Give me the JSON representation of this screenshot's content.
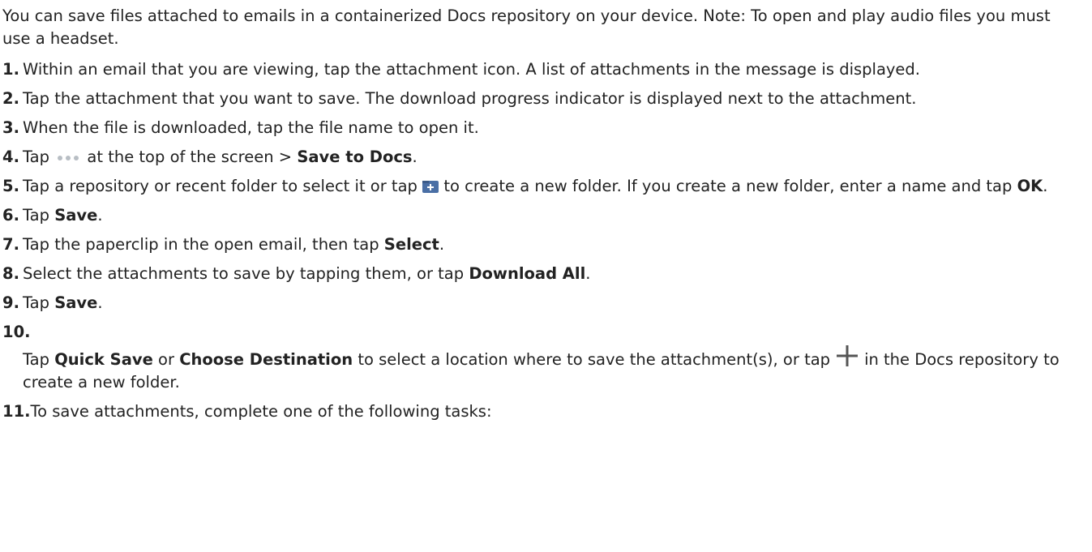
{
  "intro": "You can save files attached to emails in a containerized Docs repository on your device. Note: To open and play audio files you must use a headset.",
  "steps": [
    {
      "num": "1.",
      "text": "Within an email that you are viewing, tap the attachment icon. A list of attachments in the message is displayed."
    },
    {
      "num": "2.",
      "text": "Tap the attachment that you want to save. The download progress indicator is displayed next to the attachment."
    },
    {
      "num": "3.",
      "text": "When the file is downloaded, tap the file name to open it."
    },
    {
      "num": "4.",
      "pre": "Tap",
      "post": "at the top of the screen >",
      "bold": "Save to Docs",
      "end": "."
    },
    {
      "num": "5.",
      "pre": "Tap a repository or recent folder to select it or tap",
      "post": "to create a new folder. If you create a new folder, enter a name and tap",
      "bold": "OK",
      "end": "."
    },
    {
      "num": "6.",
      "pre": "Tap",
      "bold": "Save",
      "end": "."
    },
    {
      "num": "7.",
      "pre": "Tap the paperclip in the open email, then tap",
      "bold": "Select",
      "end": "."
    },
    {
      "num": "8.",
      "pre": "Select the attachments to save by tapping them, or tap",
      "bold": "Download All",
      "end": "."
    },
    {
      "num": "9.",
      "pre": "Tap",
      "bold": "Save",
      "end": "."
    },
    {
      "num": "10.",
      "pre": "Tap",
      "bold1": "Quick Save",
      "mid": "or",
      "bold2": "Choose Destination",
      "post": "to select a location where to save the attachment(s), or tap",
      "post2": "in the Docs repository to create a new folder."
    },
    {
      "num": "11.",
      "text": "To save attachments, complete one of the following tasks:"
    }
  ]
}
